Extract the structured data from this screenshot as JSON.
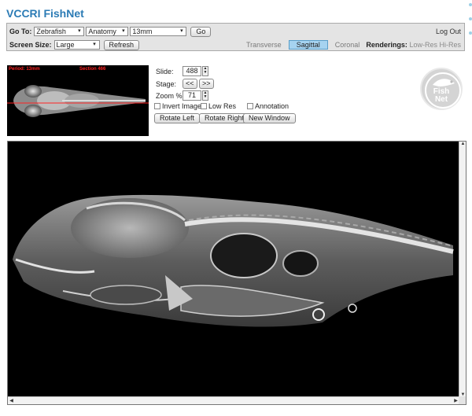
{
  "app": {
    "title": "VCCRI FishNet"
  },
  "toolbar": {
    "goto_label": "Go To:",
    "species": "Zebrafish",
    "mode": "Anatomy",
    "stage": "13mm",
    "go_label": "Go",
    "logout_label": "Log Out",
    "screen_size_label": "Screen Size:",
    "screen_size": "Large",
    "refresh_label": "Refresh",
    "views": [
      {
        "label": "Transverse",
        "active": false
      },
      {
        "label": "Sagittal",
        "active": true
      },
      {
        "label": "Coronal",
        "active": false
      }
    ],
    "renderings_label": "Renderings:",
    "renderings": [
      "Low-Res",
      "Hi-Res"
    ]
  },
  "thumbnail": {
    "period_label": "Period: 13mm",
    "section_label": "Section 466"
  },
  "controls": {
    "slide_label": "Slide:",
    "slide_value": "488",
    "stage_label": "Stage:",
    "prev_label": "<<",
    "next_label": ">>",
    "zoom_label": "Zoom %:",
    "zoom_value": "71",
    "invert_label": "Invert Image",
    "lowres_label": "Low Res",
    "annotation_label": "Annotation",
    "rotate_left_label": "Rotate Left",
    "rotate_right_label": "Rotate Right",
    "new_window_label": "New Window"
  },
  "logo": {
    "text_top": "Fish",
    "text_bottom": "Net"
  },
  "colors": {
    "title_blue": "#2b7bb5",
    "active_tab": "#a6d3f0",
    "section_line": "#ff2222"
  }
}
